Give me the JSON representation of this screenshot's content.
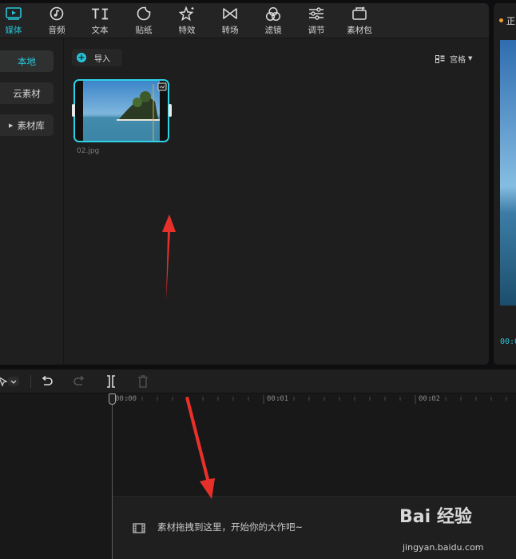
{
  "toolbar": {
    "tabs": [
      {
        "label": "媒体",
        "icon": "media-play-icon",
        "active": true
      },
      {
        "label": "音频",
        "icon": "audio-note-icon",
        "active": false
      },
      {
        "label": "文本",
        "icon": "text-ti-icon",
        "active": false
      },
      {
        "label": "贴纸",
        "icon": "sticker-icon",
        "active": false
      },
      {
        "label": "特效",
        "icon": "effects-star-icon",
        "active": false
      },
      {
        "label": "转场",
        "icon": "transition-bowtie-icon",
        "active": false
      },
      {
        "label": "滤镜",
        "icon": "filter-circles-icon",
        "active": false
      },
      {
        "label": "调节",
        "icon": "adjust-sliders-icon",
        "active": false
      },
      {
        "label": "素材包",
        "icon": "material-pack-icon",
        "active": false
      }
    ]
  },
  "sidebar": {
    "items": [
      {
        "label": "本地",
        "active": true
      },
      {
        "label": "云素材",
        "active": false
      },
      {
        "label": "素材库",
        "active": false,
        "expandable": true
      }
    ]
  },
  "media": {
    "import_label": "导入",
    "view_label": "宫格",
    "files": [
      {
        "name": "02.jpg"
      }
    ]
  },
  "preview": {
    "title": "正",
    "timecode": "00:0"
  },
  "timeline": {
    "ruler_labels": [
      "00:00",
      "00:01",
      "00:02"
    ],
    "drop_hint": "素材拖拽到这里，开始你的大作吧~"
  },
  "watermark": {
    "brand": "Bai 经验",
    "url": "jingyan.baidu.com"
  },
  "colors": {
    "accent": "#27c4d8",
    "panel": "#1e1e1e",
    "arrow": "#e8302a"
  }
}
